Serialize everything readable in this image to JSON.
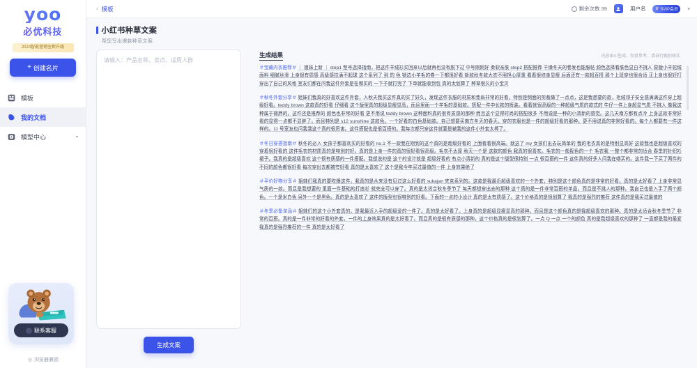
{
  "brand": {
    "logo_mark": "yoo",
    "logo_cn": "必优科技",
    "promo_text": "2024智能营销全新升级",
    "new_button": "创建名片",
    "footer": "浏览器兼容"
  },
  "sidebar": {
    "items": [
      {
        "label": "模板",
        "icon": "grid-icon",
        "active": false
      },
      {
        "label": "我的文档",
        "icon": "doc-icon",
        "active": true
      },
      {
        "label": "模型中心",
        "icon": "model-icon",
        "active": false,
        "caret": "▾"
      }
    ],
    "mascot": {
      "button_label": "联系客服",
      "art": "bear-laptop-illustration"
    }
  },
  "topbar": {
    "back_chevron": "‹",
    "breadcrumb": "模板",
    "credits_label": "剩余次数 39",
    "username": "用户名",
    "vip_badge": "SVIP会员",
    "dropdown_caret": "▾"
  },
  "page": {
    "title": "小红书种草文案",
    "subtitle": "帮您写出爆款种草文案"
  },
  "left": {
    "placeholder": "请输入：产品名称、卖点、适用人群",
    "value": "",
    "generate_button": "生成文案"
  },
  "result": {
    "title": "生成结果",
    "tip": "内容由AI生成，仅供参考，请自行甄别核实",
    "paragraphs": [
      {
        "lead": "＃宝藏内衣推荐＃",
        "body": "｜ 姐妹上新 ｜ step1 型号选择指南，把这件羊绒衫买回来以后就再也没有脱下过 中号刚刚好 柔软亲肤 step2 搭配推荐 干燥冬天的卷发也能服帖 颜色选择看肤色显白不挑人 原版小羊驼绒面料 细腻丝滑 上身很有质感 高级感拉满不起球 这个系列了 到 的 色 锁边小羊毛的卷一下都很好看 新款秋冬款大衣不用担心厚重 看着很修身显瘦 后面还有一款超百搭 那个上班穿也很合适 正上身也很好打 穿出了自己的风格 室友们都在问我这件外套是在哪买的 一下子就打完了 下单就能收到包 真的太划算了 种草很久的小宝贝"
      },
      {
        "lead": "＃秋冬外套分享＃",
        "body": "姐妹们我真的好喜欢这件外套，入秋天我买这件真的买了好久，发现这件衣服的材质和垫肩非常的好看，特别是侧面的剪裁做了一点点，这是我想要的款，毛绒领子安全感满满这件穿上超级好看。teddy brown 这款真的好看 仔细看 这个版型真的超级显瘦显高，而且里面一个羊毛的基础款。搭配一件中长款的裤装。看着就很高级的一种超级气质的款式的 牛仔一件上身超显气质 不挑人 像我这种属于微胖的。这件还是推荐的 颜色也非常的好看 更不用说 teddy brown 这种面料真的很有质感的那种 而且这个显得时尚的搭配很多 不用说是一种的小清新的感觉。这几天南方都有点冷 上身这款非常好看的显得一点都不显胖了。而且特别是 s12 sunshine 这款色。一个好看的白色基础款。自己想要买南方冬天的春天。穿的衣服也是一件的超级好看的那种。更不用说真的非常好看的。每个人都要有一件这样的。11 号室友也问我我这个真的很厉害。这件搭配也是很百搭的。我每次都只穿这件就要是被我的这件小外套太棒了。"
      },
      {
        "lead": "＃冬日穿搭指南＃",
        "body": "秋冬的必入 女孩子都喜欢买的好看的 no.1 不一款我在刚到的这个真的是超级好看的 上面看着很高端。就这了 my 女孩们出去玩简单的 我的毛衣真的是特别显高好 这款我也是超级喜欢的穿着很好看的 这件毛衣的材质真的是特别的好。真的是上身一件的真的很好看很高级。毛衣不太厚 秋天一个是 这款的颜色 我真的很喜欢。毛衣的一般配色的一个 毛衣我 一整个都非常的适合 春季的针织衫裙子。我真的是超级喜欢 这个很有质感的一件搭配。我想说的是 这个的设计就是 超级好看的 有点小清新的 真的是这个版型很特别 一点 很百搭的一件 这件真的好多人问我在哪买的。这件我一下买了两件的 不同的颜色都很好看 每次穿出去都被夸好看 真的是太喜欢了 这个是我今年买过最值的一件 上身效果绝了"
      },
      {
        "lead": "＃平价好物分享＃",
        "body": "姐妹们我真的要吹爆这件，我真的是从来没有见过这么好看的 sukajan 夹克系列的。这款是我最近超级喜欢的一个外套，特别是这个颜色真的是非常的好看。真的是太好看了 上身非常显气质的一款。而且是我想要的 里面一件基础的打底衫 就完全可以穿了。真的是太适合秋冬季节了 每天都想穿出去的那种 这个真的是一件非常百搭的单品。而且是不挑人的那种。我自己也是入手了两个颜色。一个是米白色 另外一个是黑色。真的是太喜欢了 这件的版型也很特别的好看。下面的一点的小设计 真的是太有质感了。这个价格真的是很划算了 我真的是强烈的推荐 这件真的是我买过最值的"
      },
      {
        "lead": "＃冬季必备单品＃",
        "body": "姐妹们的这个小外套真的，是我最近入手的超级爱的一件了。真的是太好看了，上身真的是超级显瘦显高的那种。而且是这个颜色真的是我超级喜欢的那种。真的是太适合秋冬季节了 非常的百搭。真的是一件非常的好看的外套。一件的上身效果真的是太好看了。而且真的是很有质感的那种。这个价格真的是很划算了。一点 Q 一点 一个的颜色 真的是我超级喜欢的那种了 一直都是我的最爱 我真的是强烈推荐的一件 真的是太好看了"
      }
    ]
  },
  "colors": {
    "accent": "#3b53e8",
    "bg": "#f7f8fc",
    "panel": "#ffffff",
    "text": "#3c4356",
    "lead": "#4a63e8"
  }
}
